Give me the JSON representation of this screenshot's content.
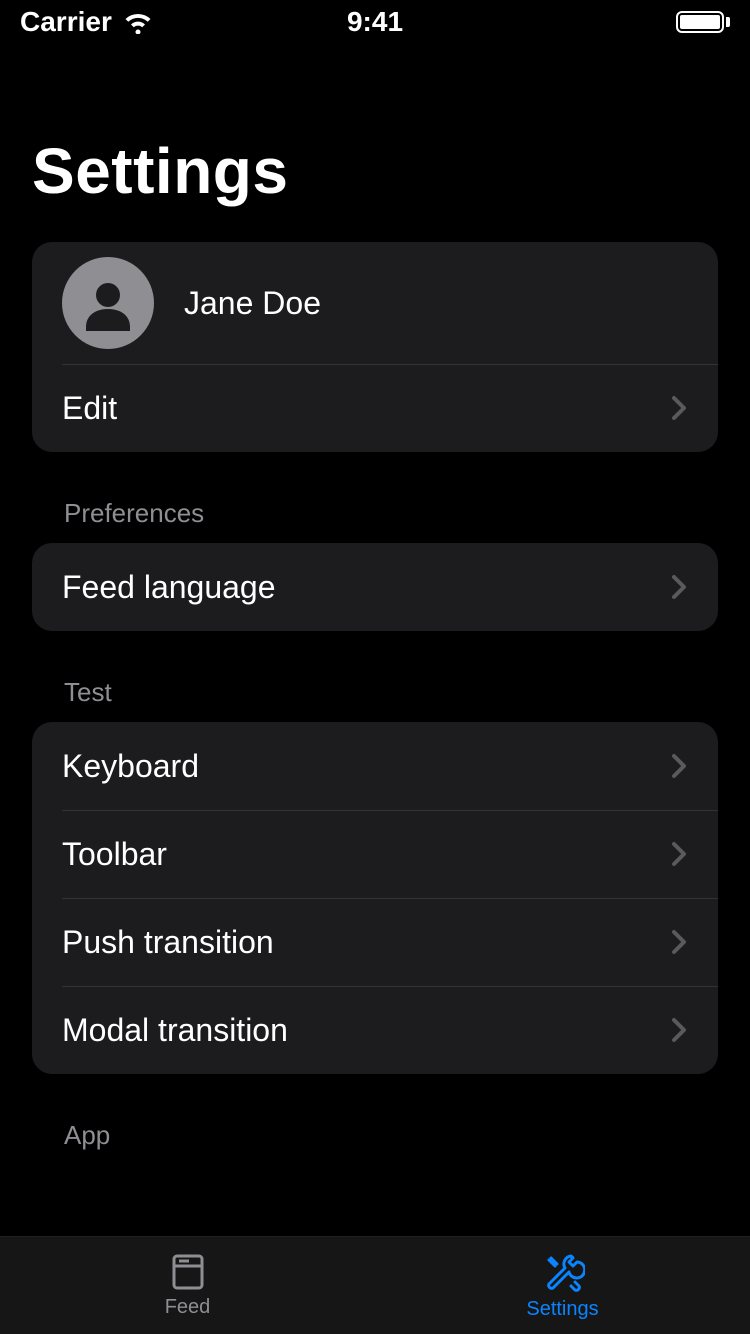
{
  "status": {
    "carrier": "Carrier",
    "time": "9:41"
  },
  "page": {
    "title": "Settings"
  },
  "profile": {
    "name": "Jane Doe",
    "edit_label": "Edit"
  },
  "sections": {
    "preferences": {
      "header": "Preferences",
      "items": [
        {
          "label": "Feed language"
        }
      ]
    },
    "test": {
      "header": "Test",
      "items": [
        {
          "label": "Keyboard"
        },
        {
          "label": "Toolbar"
        },
        {
          "label": "Push transition"
        },
        {
          "label": "Modal transition"
        }
      ]
    },
    "app": {
      "header": "App"
    }
  },
  "tabs": {
    "feed": "Feed",
    "settings": "Settings"
  }
}
